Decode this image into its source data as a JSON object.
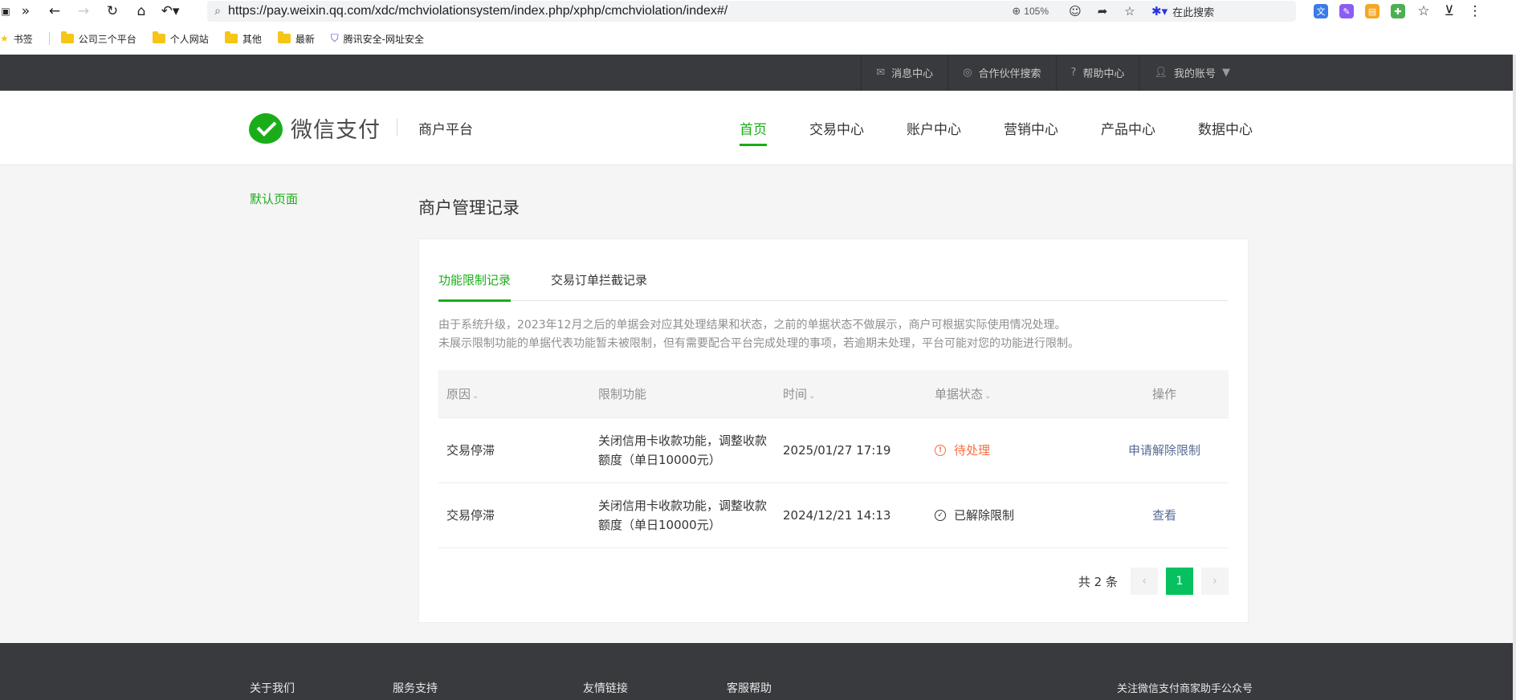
{
  "browser": {
    "url": "https://pay.weixin.qq.com/xdc/mchviolationsystem/index.php/xphp/cmchviolation/index#/",
    "zoom": "105%",
    "search_placeholder": "在此搜索",
    "bookmarks": [
      {
        "label": "书签",
        "icon": "star-icon"
      },
      {
        "label": "公司三个平台",
        "icon": "folder-icon"
      },
      {
        "label": "个人网站",
        "icon": "folder-icon"
      },
      {
        "label": "其他",
        "icon": "folder-icon"
      },
      {
        "label": "最新",
        "icon": "folder-icon"
      },
      {
        "label": "腾讯安全-网址安全",
        "icon": "shield-icon"
      }
    ]
  },
  "topbar": {
    "items": [
      {
        "label": "消息中心",
        "icon": "mail-icon"
      },
      {
        "label": "合作伙伴搜索",
        "icon": "partner-search-icon"
      },
      {
        "label": "帮助中心",
        "icon": "help-icon"
      },
      {
        "label": "我的账号",
        "icon": "user-icon"
      }
    ]
  },
  "header": {
    "logo_text": "微信支付",
    "platform": "商户平台",
    "nav": [
      "首页",
      "交易中心",
      "账户中心",
      "营销中心",
      "产品中心",
      "数据中心"
    ],
    "active_nav": "首页"
  },
  "sidebar": {
    "link": "默认页面"
  },
  "page": {
    "title": "商户管理记录",
    "tabs": [
      "功能限制记录",
      "交易订单拦截记录"
    ],
    "active_tab": "功能限制记录",
    "notice_line1": "由于系统升级，2023年12月之后的单据会对应其处理结果和状态，之前的单据状态不做展示，商户可根据实际使用情况处理。",
    "notice_line2": "未展示限制功能的单据代表功能暂未被限制，但有需要配合平台完成处理的事项，若逾期未处理，平台可能对您的功能进行限制。"
  },
  "table": {
    "headers": [
      "原因",
      "限制功能",
      "时间",
      "单据状态",
      "操作"
    ],
    "rows": [
      {
        "reason": "交易停滞",
        "func_line1": "关闭信用卡收款功能，调整收款",
        "func_line2": "额度（单日10000元）",
        "time": "2025/01/27 17:19",
        "status": "待处理",
        "action": "申请解除限制"
      },
      {
        "reason": "交易停滞",
        "func_line1": "关闭信用卡收款功能，调整收款",
        "func_line2": "额度（单日10000元）",
        "time": "2024/12/21 14:13",
        "status": "已解除限制",
        "action": "查看"
      }
    ]
  },
  "pagination": {
    "total": "共 2 条",
    "current": "1"
  },
  "footer": {
    "cols": [
      "关于我们",
      "服务支持",
      "友情链接",
      "客服帮助",
      "关注微信支付商家助手公众号"
    ]
  },
  "colors": {
    "brand": "#1aad19",
    "pending": "#fa6b3d",
    "link": "#576b95",
    "dark": "#393a3d"
  }
}
